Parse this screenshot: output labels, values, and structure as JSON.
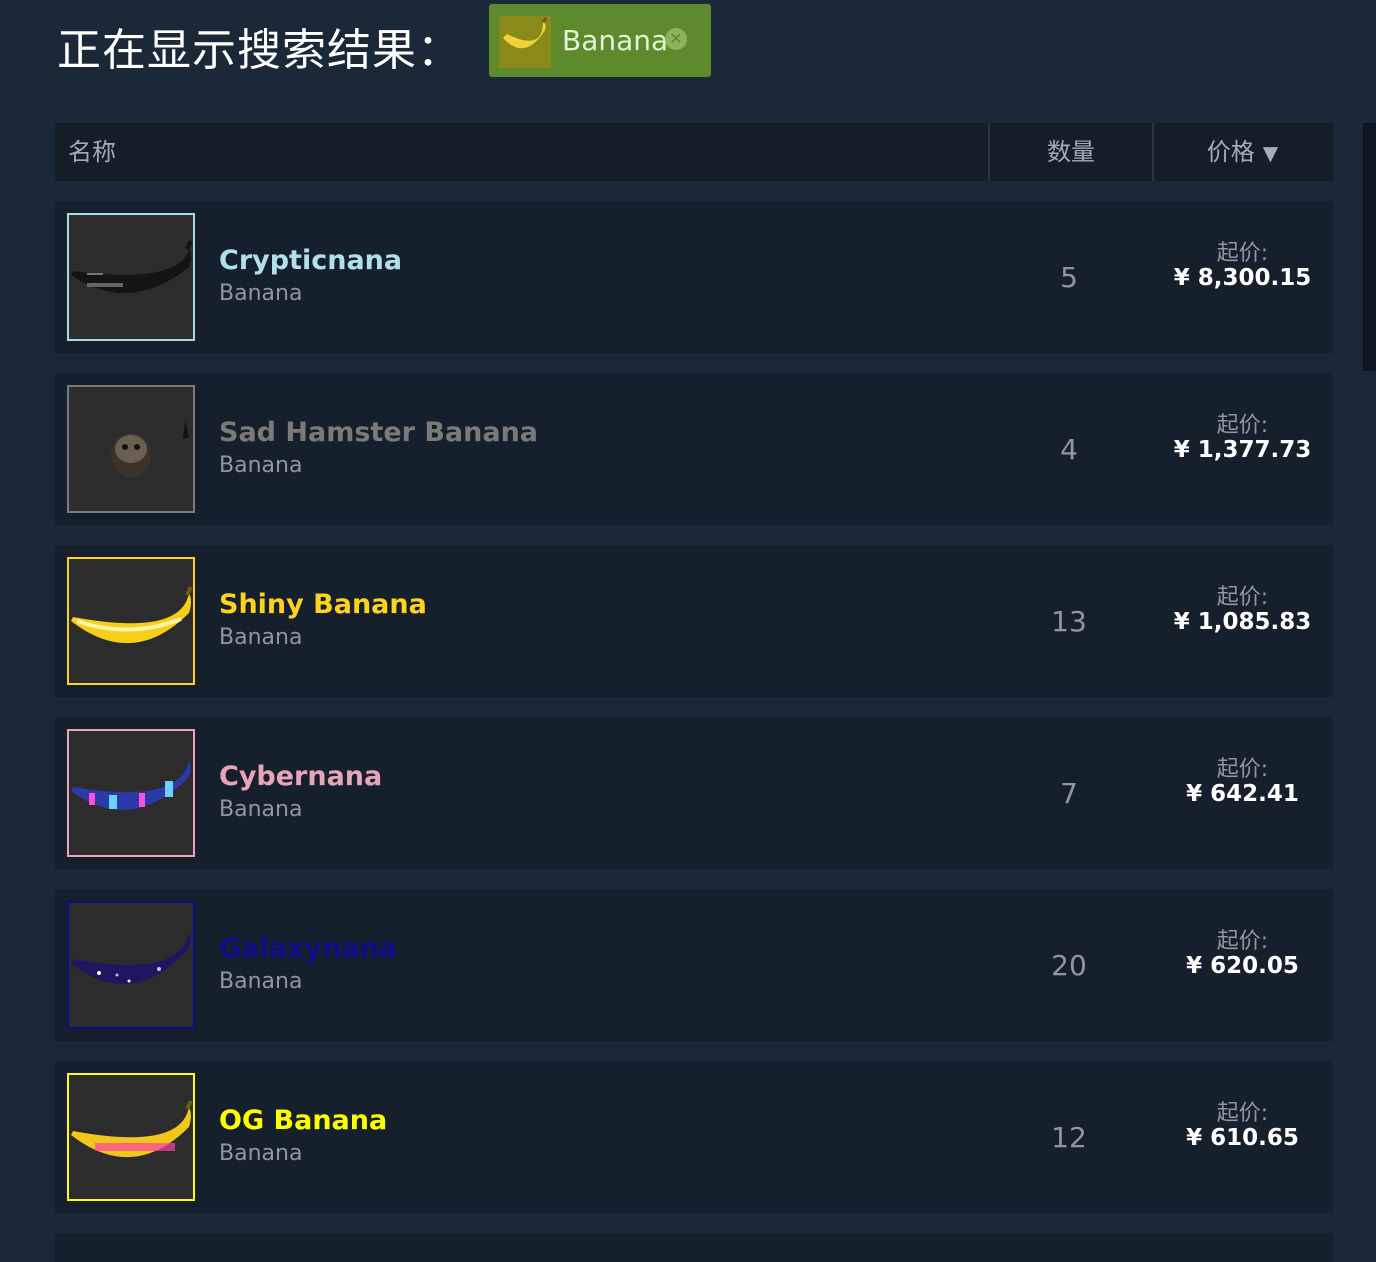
{
  "header": {
    "title": "正在显示搜索结果：",
    "filter_tag": {
      "label": "Banana",
      "close_icon": "close-circle-icon",
      "color": "#5c8a2d"
    }
  },
  "table": {
    "columns": {
      "name": "名称",
      "quantity": "数量",
      "price": "价格",
      "sort_indicator": "▼"
    },
    "price_prefix": "起价:",
    "rows": [
      {
        "name": "Crypticnana",
        "type": "Banana",
        "quantity": "5",
        "price": "¥ 8,300.15",
        "name_color": "#b0e0e8",
        "border_color": "#a7dbe4"
      },
      {
        "name": "Sad Hamster Banana",
        "type": "Banana",
        "quantity": "4",
        "price": "¥ 1,377.73",
        "name_color": "#7a7a7a",
        "border_color": "#7a7a7a"
      },
      {
        "name": "Shiny Banana",
        "type": "Banana",
        "quantity": "13",
        "price": "¥ 1,085.83",
        "name_color": "#ffd21f",
        "border_color": "#ffd21f"
      },
      {
        "name": "Cybernana",
        "type": "Banana",
        "quantity": "7",
        "price": "¥ 642.41",
        "name_color": "#e8a4b8",
        "border_color": "#e8a4b8"
      },
      {
        "name": "Galaxynana",
        "type": "Banana",
        "quantity": "20",
        "price": "¥ 620.05",
        "name_color": "#0d0d8c",
        "border_color": "#0d0d8c"
      },
      {
        "name": "OG Banana",
        "type": "Banana",
        "quantity": "12",
        "price": "¥ 610.65",
        "name_color": "#ffff00",
        "border_color": "#ffff00"
      }
    ]
  }
}
